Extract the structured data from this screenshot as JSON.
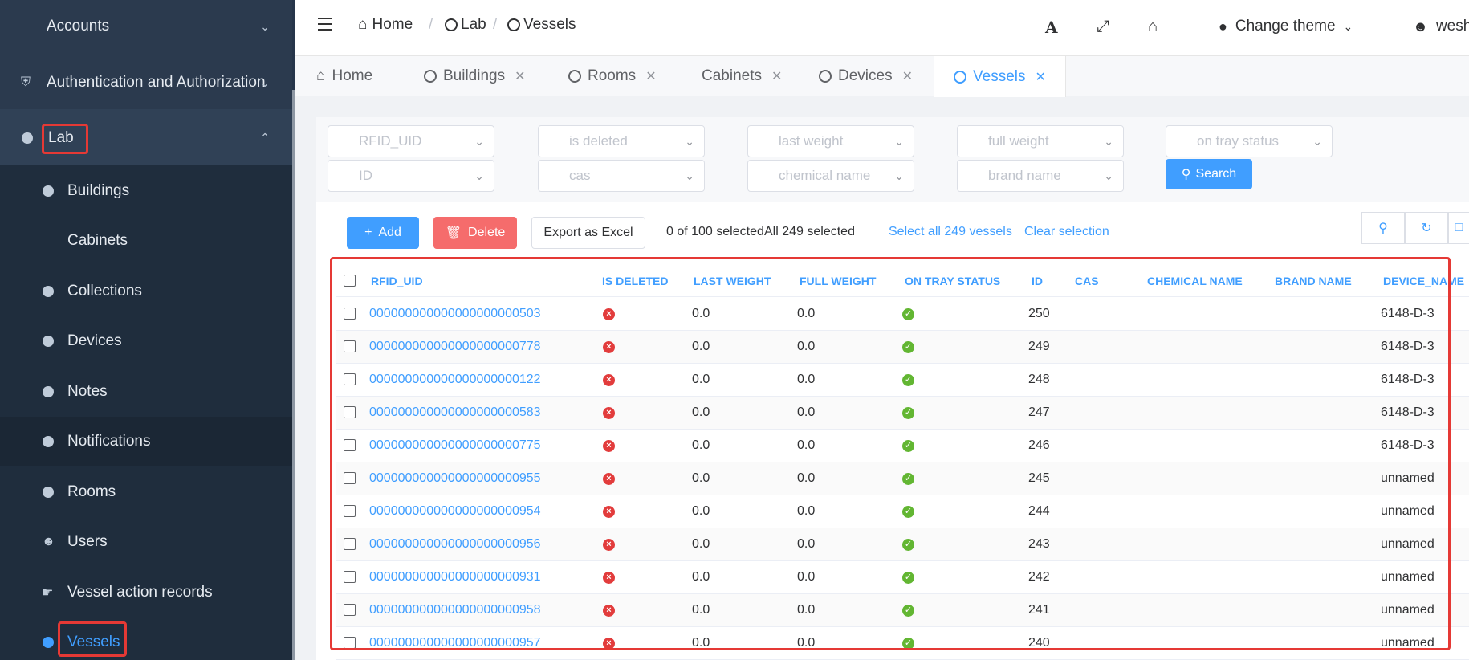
{
  "sidebar": {
    "accounts": "Accounts",
    "auth": "Authentication and Authorization",
    "lab": "Lab",
    "items": [
      {
        "label": "Buildings",
        "icon": "dot"
      },
      {
        "label": "Cabinets",
        "icon": "none"
      },
      {
        "label": "Collections",
        "icon": "dot"
      },
      {
        "label": "Devices",
        "icon": "dot"
      },
      {
        "label": "Notes",
        "icon": "dot"
      },
      {
        "label": "Notifications",
        "icon": "dot"
      },
      {
        "label": "Rooms",
        "icon": "dot"
      },
      {
        "label": "Users",
        "icon": "user-icon"
      },
      {
        "label": "Vessel action records",
        "icon": "hand-icon"
      },
      {
        "label": "Vessels",
        "icon": "dot"
      }
    ]
  },
  "header": {
    "breadcrumb": [
      "Home",
      "Lab",
      "Vessels"
    ],
    "theme_label": "Change theme",
    "user": "wesha"
  },
  "tabs": [
    {
      "label": "Home"
    },
    {
      "label": "Buildings"
    },
    {
      "label": "Rooms"
    },
    {
      "label": "Cabinets"
    },
    {
      "label": "Devices"
    },
    {
      "label": "Vessels"
    }
  ],
  "filters": {
    "row1": [
      "RFID_UID",
      "is deleted",
      "last weight",
      "full weight",
      "on tray status"
    ],
    "row2": [
      "ID",
      "cas",
      "chemical name",
      "brand name"
    ],
    "search_label": "Search"
  },
  "actions": {
    "add": "Add",
    "delete": "Delete",
    "export": "Export as Excel",
    "selected": "0 of 100 selected",
    "all_selected": "All 249 selected",
    "select_all": "Select all 249 vessels",
    "clear": "Clear selection"
  },
  "table": {
    "columns": [
      "RFID_UID",
      "IS DELETED",
      "LAST WEIGHT",
      "FULL WEIGHT",
      "ON TRAY STATUS",
      "ID",
      "CAS",
      "CHEMICAL NAME",
      "BRAND NAME",
      "DEVICE_NAME"
    ],
    "rows": [
      {
        "rfid": "000000000000000000000503",
        "last": "0.0",
        "full": "0.0",
        "id": "250",
        "device": "6148-D-3"
      },
      {
        "rfid": "000000000000000000000778",
        "last": "0.0",
        "full": "0.0",
        "id": "249",
        "device": "6148-D-3"
      },
      {
        "rfid": "000000000000000000000122",
        "last": "0.0",
        "full": "0.0",
        "id": "248",
        "device": "6148-D-3"
      },
      {
        "rfid": "000000000000000000000583",
        "last": "0.0",
        "full": "0.0",
        "id": "247",
        "device": "6148-D-3"
      },
      {
        "rfid": "000000000000000000000775",
        "last": "0.0",
        "full": "0.0",
        "id": "246",
        "device": "6148-D-3"
      },
      {
        "rfid": "000000000000000000000955",
        "last": "0.0",
        "full": "0.0",
        "id": "245",
        "device": "unnamed"
      },
      {
        "rfid": "000000000000000000000954",
        "last": "0.0",
        "full": "0.0",
        "id": "244",
        "device": "unnamed"
      },
      {
        "rfid": "000000000000000000000956",
        "last": "0.0",
        "full": "0.0",
        "id": "243",
        "device": "unnamed"
      },
      {
        "rfid": "000000000000000000000931",
        "last": "0.0",
        "full": "0.0",
        "id": "242",
        "device": "unnamed"
      },
      {
        "rfid": "000000000000000000000958",
        "last": "0.0",
        "full": "0.0",
        "id": "241",
        "device": "unnamed"
      },
      {
        "rfid": "000000000000000000000957",
        "last": "0.0",
        "full": "0.0",
        "id": "240",
        "device": "unnamed"
      }
    ]
  },
  "colors": {
    "accent": "#409eff",
    "danger": "#f56c6c",
    "highlight": "#e53935",
    "sidebar": "#304156"
  }
}
